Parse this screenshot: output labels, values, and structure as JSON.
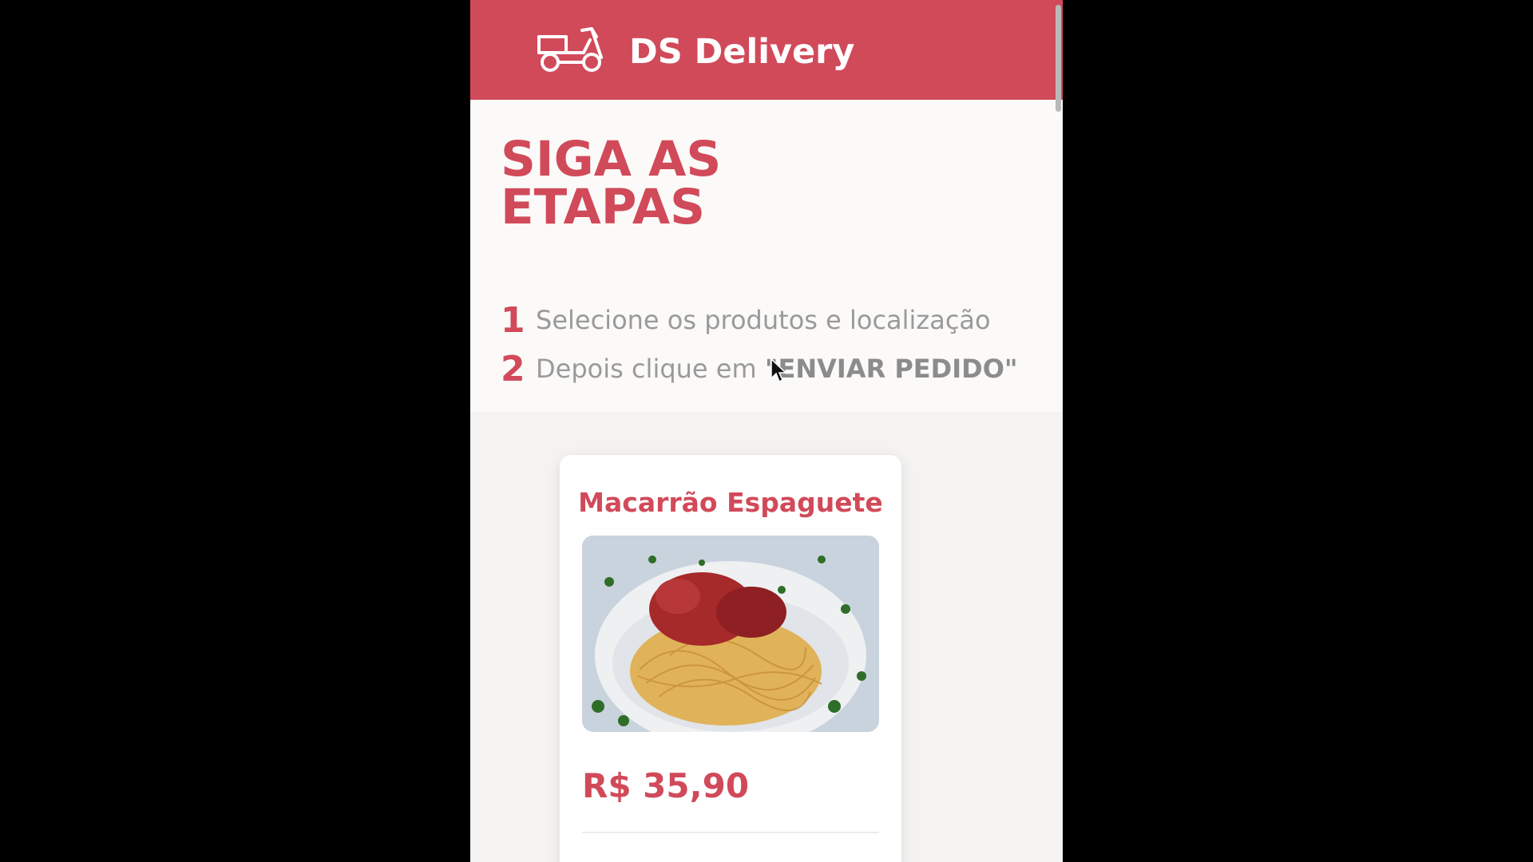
{
  "header": {
    "brand": "DS Delivery",
    "logo_icon": "scooter-icon",
    "color": "#d14a5a"
  },
  "hero": {
    "title_line1": "SIGA AS",
    "title_line2": "ETAPAS",
    "steps": [
      {
        "number": "1",
        "text": "Selecione os produtos e localização"
      },
      {
        "number": "2",
        "text": "Depois clique em ",
        "strong": "\"ENVIAR PEDIDO\""
      }
    ]
  },
  "products": [
    {
      "name": "Macarrão Espaguete",
      "price": "R$ 35,90",
      "image_icon": "spaghetti-dish-image"
    }
  ]
}
